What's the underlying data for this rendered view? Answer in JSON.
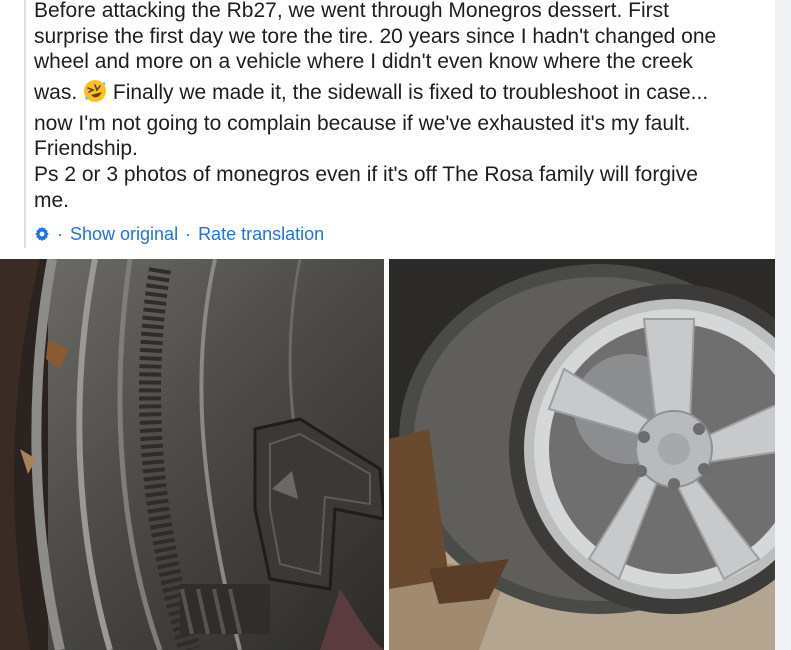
{
  "post": {
    "lines": [
      "Before attacking the Rb27, we went through Monegros dessert. First",
      "surprise the first day we tore the tire. 20 years since I hadn't changed one",
      "wheel and more on a vehicle where I didn't even know where the creek",
      "was.",
      "Finally we made it, the sidewall is fixed to troubleshoot in case...",
      "now I'm not going to complain because if we've exhausted it's my fault.",
      "Friendship.",
      "Ps 2 or 3 photos of monegros even if it's off The Rosa family will forgive",
      "me."
    ],
    "emoji": "rolling-on-floor-laughing-emoji"
  },
  "translation": {
    "show_original": "Show original",
    "separator": "·",
    "rate_translation": "Rate translation",
    "settings_icon": "gear-icon"
  },
  "photos": [
    {
      "name": "photo-tire-sidewall",
      "icon": "tire-closeup-photo"
    },
    {
      "name": "photo-flat-wheel",
      "icon": "wheel-photo"
    }
  ],
  "colors": {
    "text": "#1c1e21",
    "link": "#1b74e4",
    "bar": "#dcdfe4"
  }
}
